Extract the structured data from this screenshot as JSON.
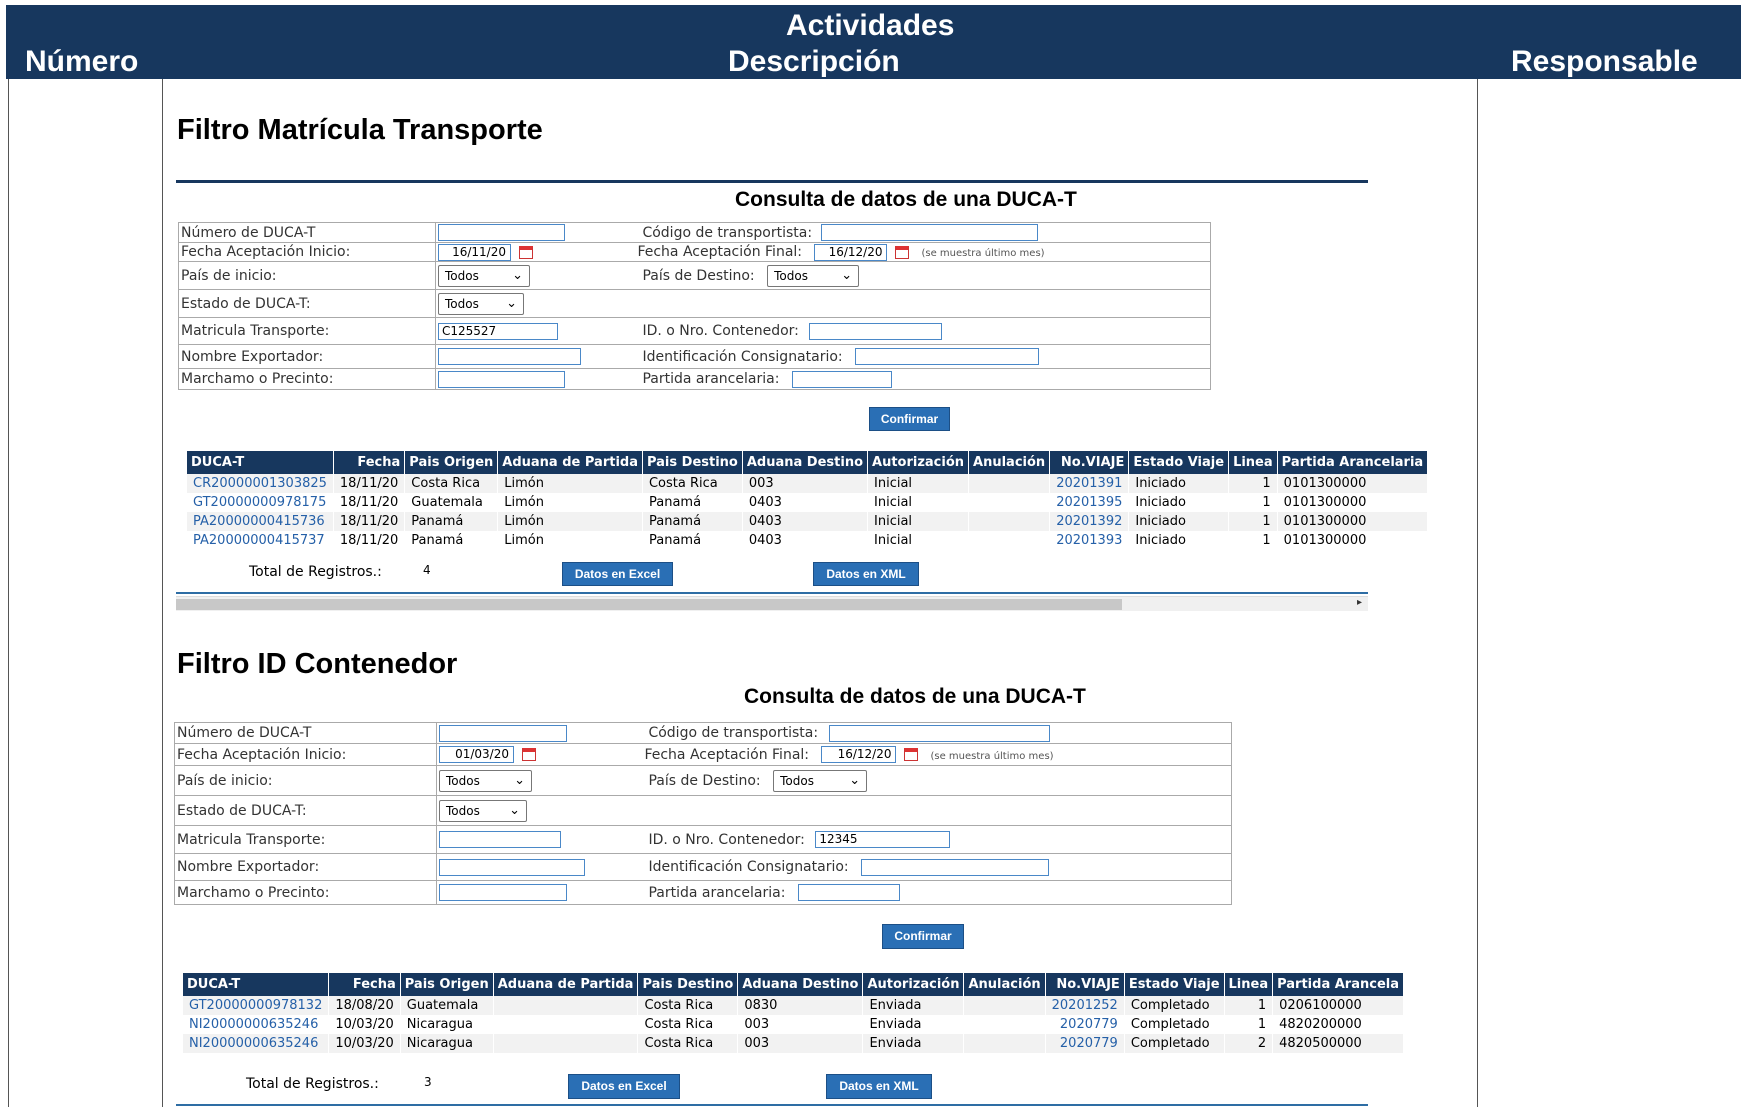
{
  "header": {
    "top_label": "Actividades",
    "col_number": "Número",
    "col_description": "Descripción",
    "col_responsible": "Responsable"
  },
  "section1": {
    "title": "Filtro Matrícula Transporte",
    "query_title": "Consulta de datos de una DUCA-T",
    "form": {
      "duca_label": "Número de DUCA-T",
      "duca_value": "",
      "carrier_label": "Código de transportista:",
      "carrier_value": "",
      "start_date_label": "Fecha Aceptación Inicio:",
      "start_date_value": "16/11/20",
      "end_date_label": "Fecha Aceptación Final:",
      "end_date_value": "16/12/20",
      "end_note": "(se muestra último mes)",
      "origin_label": "País de inicio:",
      "origin_value": "Todos",
      "dest_label": "País de Destino:",
      "dest_value": "Todos",
      "state_label": "Estado de DUCA-T:",
      "state_value": "Todos",
      "plate_label": "Matricula Transporte:",
      "plate_value": "C125527",
      "container_label": "ID. o Nro. Contenedor:",
      "container_value": "",
      "exporter_label": "Nombre Exportador:",
      "exporter_value": "",
      "consignee_label": "Identificación Consignatario:",
      "consignee_value": "",
      "seal_label": "Marchamo o Precinto:",
      "seal_value": "",
      "tariff_label": "Partida arancelaria:",
      "tariff_value": ""
    },
    "confirm": "Confirmar",
    "columns": [
      "DUCA-T",
      "Fecha",
      "Pais Origen",
      "Aduana de Partida",
      "Pais Destino",
      "Aduana Destino",
      "Autorización",
      "Anulación",
      "No.VIAJE",
      "Estado Viaje",
      "Linea",
      "Partida Arancelaria"
    ],
    "rows": [
      [
        "CR20000001303825",
        "18/11/20",
        "Costa Rica",
        "Limón",
        "Costa Rica",
        "003",
        "Inicial",
        "",
        "20201391",
        "Iniciado",
        "1",
        "0101300000"
      ],
      [
        "GT20000000978175",
        "18/11/20",
        "Guatemala",
        "Limón",
        "Panamá",
        "0403",
        "Inicial",
        "",
        "20201395",
        "Iniciado",
        "1",
        "0101300000"
      ],
      [
        "PA20000000415736",
        "18/11/20",
        "Panamá",
        "Limón",
        "Panamá",
        "0403",
        "Inicial",
        "",
        "20201392",
        "Iniciado",
        "1",
        "0101300000"
      ],
      [
        "PA20000000415737",
        "18/11/20",
        "Panamá",
        "Limón",
        "Panamá",
        "0403",
        "Inicial",
        "",
        "20201393",
        "Iniciado",
        "1",
        "0101300000"
      ]
    ],
    "total_label": "Total de Registros.:",
    "total_value": "4",
    "excel": "Datos en Excel",
    "xml": "Datos en XML"
  },
  "section2": {
    "title": "Filtro ID Contenedor",
    "query_title": "Consulta de datos de una DUCA-T",
    "form": {
      "duca_label": "Número de DUCA-T",
      "duca_value": "",
      "carrier_label": "Código de transportista:",
      "carrier_value": "",
      "start_date_label": "Fecha Aceptación Inicio:",
      "start_date_value": "01/03/20",
      "end_date_label": "Fecha Aceptación Final:",
      "end_date_value": "16/12/20",
      "end_note": "(se muestra último mes)",
      "origin_label": "País de inicio:",
      "origin_value": "Todos",
      "dest_label": "País de Destino:",
      "dest_value": "Todos",
      "state_label": "Estado de DUCA-T:",
      "state_value": "Todos",
      "plate_label": "Matricula Transporte:",
      "plate_value": "",
      "container_label": "ID. o Nro. Contenedor:",
      "container_value": "12345",
      "exporter_label": "Nombre Exportador:",
      "exporter_value": "",
      "consignee_label": "Identificación Consignatario:",
      "consignee_value": "",
      "seal_label": "Marchamo o Precinto:",
      "seal_value": "",
      "tariff_label": "Partida arancelaria:",
      "tariff_value": ""
    },
    "confirm": "Confirmar",
    "columns": [
      "DUCA-T",
      "Fecha",
      "Pais Origen",
      "Aduana de Partida",
      "Pais Destino",
      "Aduana Destino",
      "Autorización",
      "Anulación",
      "No.VIAJE",
      "Estado Viaje",
      "Linea",
      "Partida Arancela"
    ],
    "rows": [
      [
        "GT20000000978132",
        "18/08/20",
        "Guatemala",
        "",
        "Costa Rica",
        "0830",
        "Enviada",
        "",
        "20201252",
        "Completado",
        "1",
        "0206100000"
      ],
      [
        "NI20000000635246",
        "10/03/20",
        "Nicaragua",
        "",
        "Costa Rica",
        "003",
        "Enviada",
        "",
        "2020779",
        "Completado",
        "1",
        "4820200000"
      ],
      [
        "NI20000000635246",
        "10/03/20",
        "Nicaragua",
        "",
        "Costa Rica",
        "003",
        "Enviada",
        "",
        "2020779",
        "Completado",
        "2",
        "4820500000"
      ]
    ],
    "total_label": "Total de Registros.:",
    "total_value": "3",
    "excel": "Datos en Excel",
    "xml": "Datos en XML"
  }
}
